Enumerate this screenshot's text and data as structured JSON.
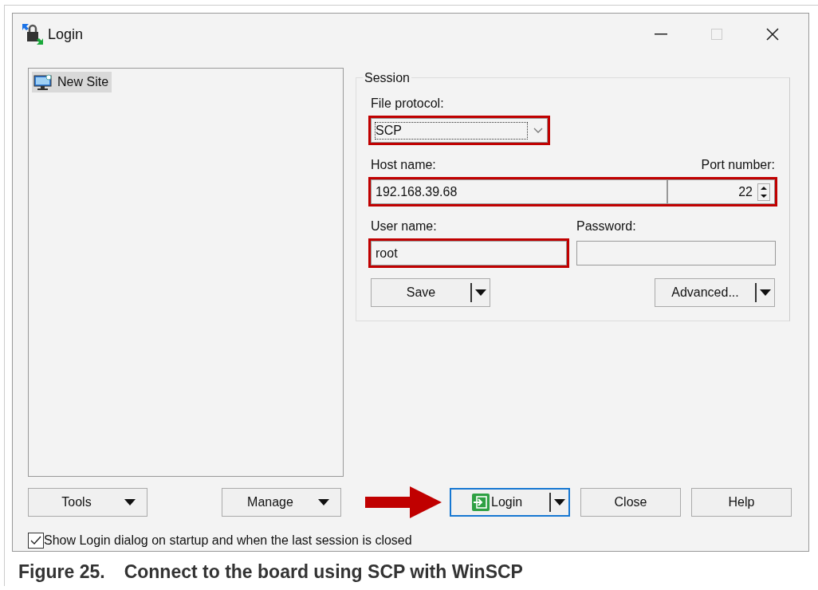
{
  "window": {
    "title": "Login"
  },
  "sites": [
    {
      "label": "New Site",
      "selected": true
    }
  ],
  "session": {
    "title": "Session",
    "file_protocol": {
      "label": "File protocol:",
      "value": "SCP",
      "highlighted": true
    },
    "server": {
      "highlighted": true,
      "host_name": {
        "label": "Host name:",
        "value": "192.168.39.68"
      },
      "port_number": {
        "label": "Port number:",
        "value": "22"
      }
    },
    "user_name": {
      "label": "User name:",
      "value": "root",
      "highlighted": true
    },
    "password": {
      "label": "Password:",
      "highlighted": false
    },
    "buttons": [
      {
        "label": "Save"
      },
      {
        "label": "Advanced..."
      }
    ]
  },
  "buttons": [
    {
      "label": "Tools",
      "kind": "menu",
      "default": false
    },
    {
      "label": "Manage",
      "kind": "menu",
      "default": false
    },
    {
      "label": "Login",
      "kind": "split",
      "default": true
    },
    {
      "label": "Close",
      "kind": "plain",
      "default": false
    },
    {
      "label": "Help",
      "kind": "plain",
      "default": false
    }
  ],
  "show_on_startup": {
    "label": "Show Login dialog on startup and when the last session is closed",
    "checked": true
  },
  "caption": {
    "number": "Figure 25.",
    "text": "Connect to the board using SCP with WinSCP"
  }
}
